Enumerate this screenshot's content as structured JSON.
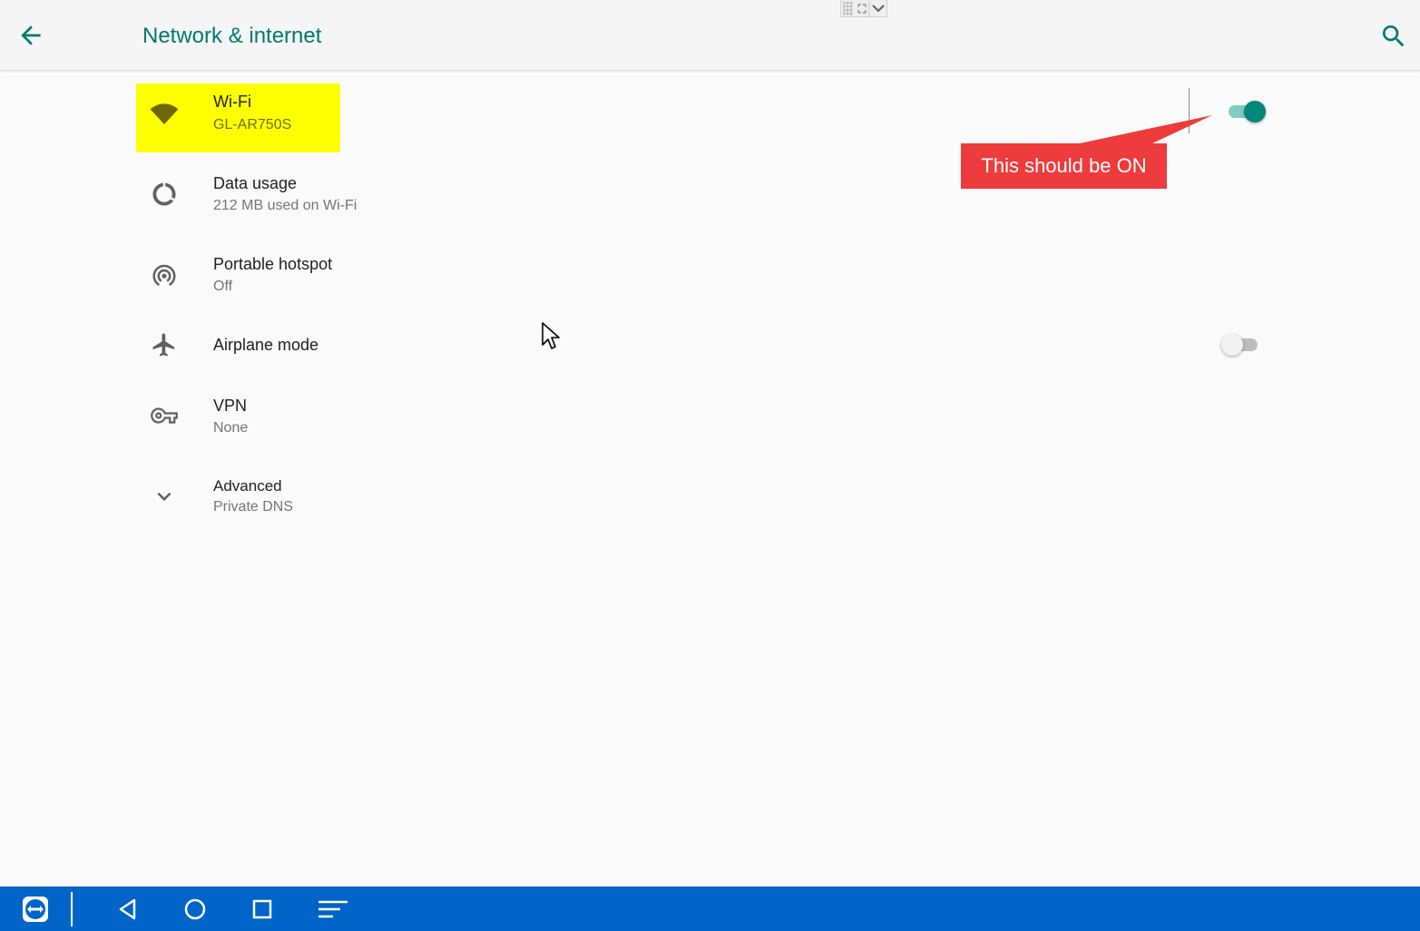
{
  "header": {
    "title": "Network & internet"
  },
  "items": [
    {
      "primary": "Wi-Fi",
      "secondary": "GL-AR750S",
      "toggle": "on"
    },
    {
      "primary": "Data usage",
      "secondary": "212 MB used on Wi-Fi"
    },
    {
      "primary": "Portable hotspot",
      "secondary": "Off"
    },
    {
      "primary": "Airplane mode",
      "toggle": "off"
    },
    {
      "primary": "VPN",
      "secondary": "None"
    },
    {
      "primary": "Advanced",
      "secondary": "Private DNS"
    }
  ],
  "annotation": {
    "text": "This should be ON",
    "color": "#ee3b3b"
  },
  "colors": {
    "accent": "#00796b",
    "highlight": "#ffff00",
    "navbar": "#0064c8"
  },
  "icons": {
    "header": [
      "back-arrow-icon",
      "search-icon"
    ],
    "items": [
      "wifi-icon",
      "data-usage-icon",
      "hotspot-icon",
      "airplane-icon",
      "vpn-key-icon",
      "chevron-down-icon"
    ],
    "navbar": [
      "teamviewer-icon",
      "back-triangle-icon",
      "home-circle-icon",
      "recents-square-icon",
      "menu-lines-icon"
    ]
  }
}
